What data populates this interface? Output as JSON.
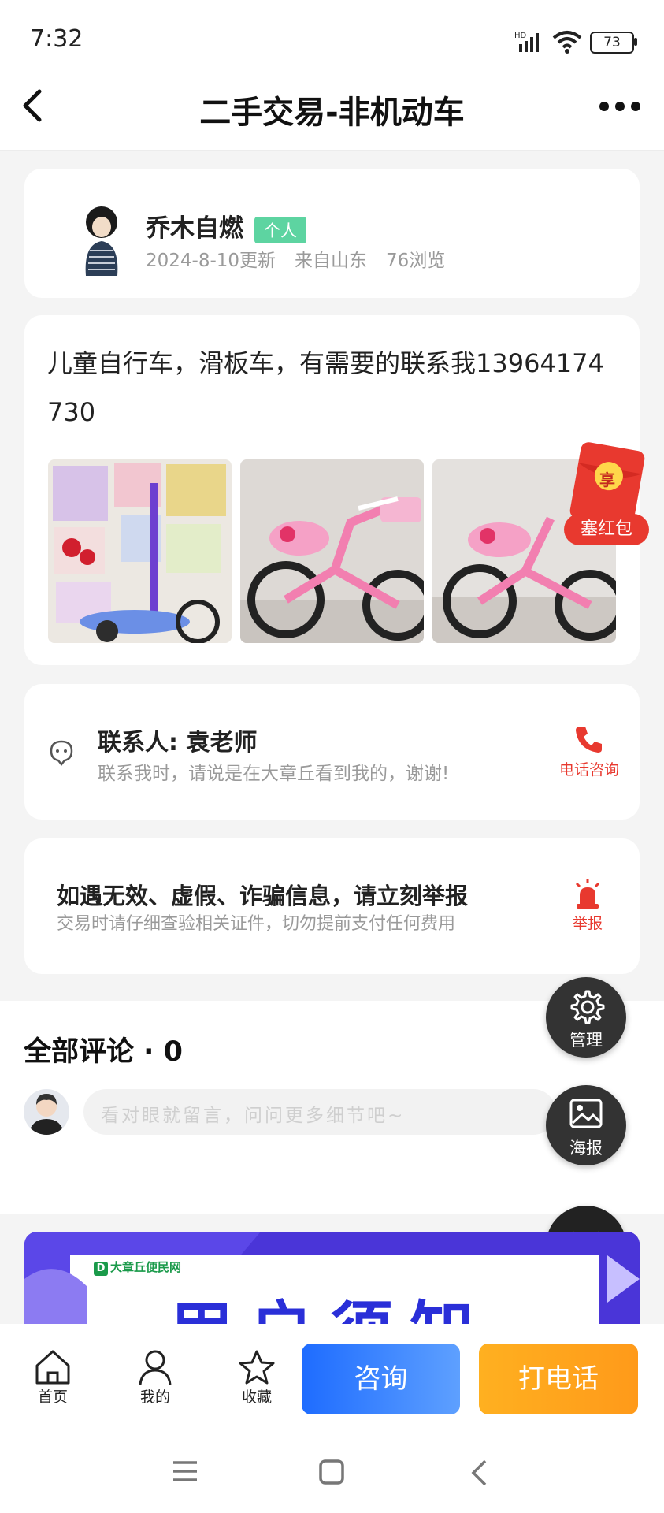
{
  "status_bar": {
    "time": "7:32",
    "battery": "73"
  },
  "header": {
    "title": "二手交易-非机动车"
  },
  "poster": {
    "name": "乔木自燃",
    "tag": "个人",
    "updated": "2024-8-10更新",
    "from": "来自山东",
    "views": "76浏览"
  },
  "post": {
    "text": "儿童自行车，滑板车，有需要的联系我13964174730",
    "red_packet": {
      "badge": "享",
      "label": "塞红包"
    }
  },
  "contact": {
    "title": "联系人: 袁老师",
    "subtitle": "联系我时，请说是在大章丘看到我的，谢谢!",
    "call_label": "电话咨询"
  },
  "report": {
    "title": "如遇无效、虚假、诈骗信息，请立刻举报",
    "subtitle": "交易时请仔细查验相关证件，切勿提前支付任何费用",
    "report_label": "举报"
  },
  "comments": {
    "title": "全部评论 · 0",
    "placeholder": "看对眼就留言，问问更多细节吧~"
  },
  "fabs": {
    "manage": "管理",
    "poster": "海报"
  },
  "banner": {
    "logo_text": "大章丘便民网",
    "big_text": "用户须知"
  },
  "bottom_nav": {
    "home": "首页",
    "mine": "我的",
    "favorite": "收藏",
    "consult": "咨询",
    "call": "打电话"
  },
  "colors": {
    "accent_green": "#5dd4a1",
    "red": "#e8392f",
    "blue": "#2f7bff",
    "orange": "#ffa31a"
  }
}
